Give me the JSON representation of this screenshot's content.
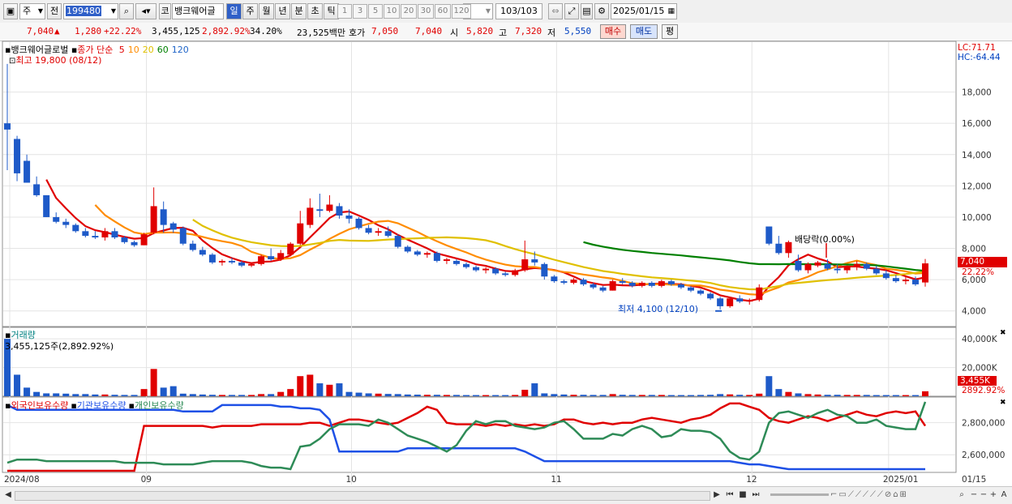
{
  "toolbar": {
    "market_type": "주",
    "prev_label": "전",
    "stock_code": "199480",
    "stock_name_tag": "코",
    "stock_name": "뱅크웨어글",
    "period_tabs": [
      "일",
      "주",
      "월",
      "년",
      "분",
      "초",
      "틱"
    ],
    "active_period": "일",
    "interval_buttons": [
      "1",
      "3",
      "5",
      "10",
      "20",
      "30",
      "60",
      "120"
    ],
    "page_counter": "103/103",
    "date": "2025/01/15"
  },
  "quote": {
    "price": "7,040",
    "change_arrow": "▲",
    "change": "1,280",
    "change_pct": "+22.22%",
    "volume": "3,455,125",
    "volume_pct": "2,892.92%",
    "turnover_pct": "34.20%",
    "amount": "23,525백만",
    "bid_label": "호가",
    "bid1": "7,050",
    "bid2": "7,040",
    "open_label": "시",
    "open": "5,820",
    "high_label": "고",
    "high": "7,320",
    "low_label": "저",
    "low": "5,550",
    "buy_label": "매수",
    "sell_label": "매도",
    "eval_label": "평"
  },
  "price_panel": {
    "stock_label": "뱅크웨어글로벌",
    "ma_prefix": "종가 단순",
    "ma_periods": [
      "5",
      "10",
      "20",
      "60",
      "120"
    ],
    "ma_colors": [
      "#e00000",
      "#ff8c00",
      "#e0c000",
      "#008000",
      "#1e64c8"
    ],
    "lc": "LC:71.71",
    "hc": "HC:-64.44",
    "highest_annotation": "최고 19,800 (08/12)",
    "lowest_annotation": "최저 4,100 (12/10)",
    "dividend_annotation": "배당락(0.00%)",
    "y_ticks": [
      "18,000",
      "16,000",
      "14,000",
      "12,000",
      "10,000",
      "8,000",
      "6,000",
      "4,000"
    ],
    "last_price_tag": "7,040",
    "last_pct_tag": "22.22%"
  },
  "volume_panel": {
    "label": "거래량",
    "value_text": "3,455,125주(2,892.92%)",
    "y_ticks": [
      "40,000K",
      "20,000K"
    ],
    "last_tag": "3,455K",
    "last_pct_tag": "2892.92%"
  },
  "holdings_panel": {
    "labels": [
      "외국인보유수량",
      "기관보유수량",
      "개인보유수량"
    ],
    "colors": [
      "#e00000",
      "#1e50e6",
      "#2e8b57"
    ],
    "y_ticks": [
      "2,800,000",
      "2,600,000"
    ]
  },
  "x_axis": {
    "labels": [
      "2024/08",
      "09",
      "10",
      "11",
      "12",
      "2025/01"
    ],
    "right_label": "01/15"
  },
  "chart_data": {
    "type": "candlestick",
    "ohlc": [
      [
        16000,
        19800,
        13000,
        15600
      ],
      [
        15000,
        15200,
        12300,
        12800
      ],
      [
        13600,
        14000,
        12200,
        12200
      ],
      [
        12100,
        12600,
        11300,
        11400
      ],
      [
        11400,
        11400,
        10000,
        10000
      ],
      [
        10000,
        10300,
        9600,
        9700
      ],
      [
        9700,
        9900,
        9300,
        9500
      ],
      [
        9500,
        9600,
        9000,
        9100
      ],
      [
        9100,
        9300,
        8700,
        8800
      ],
      [
        8800,
        9100,
        8600,
        8700
      ],
      [
        8700,
        9300,
        8500,
        9100
      ],
      [
        9100,
        9300,
        8600,
        8700
      ],
      [
        8700,
        8800,
        8300,
        8400
      ],
      [
        8400,
        8500,
        8100,
        8200
      ],
      [
        8200,
        9000,
        8200,
        8900
      ],
      [
        9000,
        11900,
        8900,
        10700
      ],
      [
        10500,
        11000,
        9000,
        9500
      ],
      [
        9600,
        9700,
        9000,
        9200
      ],
      [
        9300,
        9400,
        8200,
        8300
      ],
      [
        8300,
        8500,
        7800,
        7900
      ],
      [
        7900,
        8100,
        7500,
        7600
      ],
      [
        7600,
        7700,
        7000,
        7100
      ],
      [
        7100,
        7300,
        6900,
        7200
      ],
      [
        7200,
        7400,
        7000,
        7100
      ],
      [
        7100,
        7200,
        6800,
        6900
      ],
      [
        6900,
        7100,
        6800,
        7000
      ],
      [
        7000,
        7600,
        6900,
        7500
      ],
      [
        7500,
        8000,
        7200,
        7300
      ],
      [
        7300,
        7900,
        7200,
        7700
      ],
      [
        7600,
        8400,
        7500,
        8300
      ],
      [
        8300,
        10400,
        8200,
        9600
      ],
      [
        9500,
        11200,
        9300,
        10600
      ],
      [
        10500,
        11500,
        10000,
        10400
      ],
      [
        10400,
        11400,
        10300,
        10800
      ],
      [
        10700,
        10900,
        9900,
        10100
      ],
      [
        10100,
        10500,
        9600,
        9900
      ],
      [
        9900,
        10000,
        9200,
        9300
      ],
      [
        9300,
        9500,
        8900,
        9000
      ],
      [
        9000,
        9300,
        8800,
        9100
      ],
      [
        9100,
        9400,
        8700,
        8800
      ],
      [
        8800,
        8900,
        8000,
        8100
      ],
      [
        8100,
        8200,
        7700,
        7800
      ],
      [
        7800,
        7900,
        7500,
        7600
      ],
      [
        7600,
        7800,
        7400,
        7700
      ],
      [
        7700,
        7800,
        7100,
        7200
      ],
      [
        7200,
        7400,
        7000,
        7300
      ],
      [
        7200,
        7300,
        6900,
        7000
      ],
      [
        7000,
        7100,
        6700,
        6800
      ],
      [
        6800,
        6900,
        6500,
        6600
      ],
      [
        6600,
        6800,
        6400,
        6700
      ],
      [
        6700,
        6800,
        6300,
        6400
      ],
      [
        6400,
        6500,
        6200,
        6300
      ],
      [
        6300,
        6700,
        6200,
        6600
      ],
      [
        6600,
        8500,
        6500,
        7300
      ],
      [
        7300,
        7800,
        6900,
        7100
      ],
      [
        7000,
        7100,
        6000,
        6200
      ],
      [
        6200,
        6300,
        5800,
        5900
      ],
      [
        5900,
        6000,
        5700,
        5800
      ],
      [
        5800,
        6100,
        5700,
        6000
      ],
      [
        6000,
        6100,
        5600,
        5700
      ],
      [
        5700,
        5800,
        5400,
        5500
      ],
      [
        5500,
        5600,
        5200,
        5300
      ],
      [
        5300,
        6000,
        5300,
        5900
      ],
      [
        5900,
        6100,
        5700,
        5800
      ],
      [
        5800,
        5900,
        5500,
        5600
      ],
      [
        5600,
        5900,
        5500,
        5800
      ],
      [
        5800,
        5900,
        5500,
        5600
      ],
      [
        5600,
        6000,
        5500,
        5900
      ],
      [
        5900,
        6000,
        5600,
        5700
      ],
      [
        5700,
        5800,
        5400,
        5500
      ],
      [
        5500,
        5600,
        5200,
        5300
      ],
      [
        5300,
        5400,
        5000,
        5100
      ],
      [
        5100,
        5200,
        4700,
        4800
      ],
      [
        4800,
        4900,
        4100,
        4300
      ],
      [
        4300,
        4900,
        4200,
        4800
      ],
      [
        4800,
        5000,
        4500,
        4600
      ],
      [
        4600,
        4800,
        4400,
        4700
      ],
      [
        4700,
        5700,
        4600,
        5500
      ],
      [
        9400,
        9400,
        8200,
        8300
      ],
      [
        8300,
        8800,
        7600,
        7700
      ],
      [
        7700,
        8500,
        7400,
        8400
      ],
      [
        7200,
        7600,
        6500,
        6600
      ],
      [
        6600,
        7100,
        6400,
        7000
      ],
      [
        6900,
        7200,
        6800,
        7100
      ],
      [
        7000,
        7300,
        6600,
        6700
      ],
      [
        6700,
        7000,
        6400,
        6600
      ],
      [
        6600,
        6900,
        6400,
        6800
      ],
      [
        6800,
        7200,
        6600,
        7000
      ],
      [
        7000,
        7100,
        6600,
        6700
      ],
      [
        6700,
        6900,
        6300,
        6400
      ],
      [
        6400,
        6600,
        6000,
        6100
      ],
      [
        6100,
        6300,
        5800,
        5900
      ],
      [
        5900,
        6200,
        5700,
        6000
      ],
      [
        6000,
        6200,
        5600,
        5700
      ],
      [
        5820,
        7320,
        5550,
        7040
      ]
    ],
    "volume_k": [
      40000,
      15000,
      6000,
      3000,
      2000,
      2000,
      1800,
      1500,
      1500,
      1200,
      1200,
      1000,
      900,
      900,
      5000,
      19000,
      6000,
      7000,
      1800,
      1500,
      1200,
      1000,
      900,
      900,
      900,
      900,
      1500,
      1500,
      3000,
      5000,
      14000,
      15000,
      9000,
      8000,
      9000,
      3000,
      2500,
      2000,
      1800,
      1600,
      1500,
      1200,
      1100,
      1000,
      1000,
      900,
      900,
      800,
      800,
      800,
      800,
      800,
      900,
      4500,
      9000,
      2000,
      1500,
      1200,
      1000,
      1000,
      900,
      900,
      1500,
      1000,
      900,
      900,
      900,
      900,
      800,
      800,
      800,
      900,
      1000,
      1500,
      1300,
      1000,
      900,
      1800,
      14000,
      5000,
      3000,
      2000,
      1500,
      1200,
      1000,
      1000,
      900,
      900,
      900,
      800,
      800,
      800,
      800,
      800,
      3455
    ],
    "holdings_foreign": [
      2500000,
      2500000,
      2500000,
      2500000,
      2500000,
      2500000,
      2500000,
      2500000,
      2500000,
      2500000,
      2500000,
      2500000,
      2500000,
      2500000,
      2780000,
      2780000,
      2780000,
      2780000,
      2780000,
      2780000,
      2780000,
      2770000,
      2780000,
      2780000,
      2780000,
      2780000,
      2790000,
      2790000,
      2790000,
      2790000,
      2790000,
      2800000,
      2800000,
      2780000,
      2800000,
      2820000,
      2820000,
      2810000,
      2800000,
      2790000,
      2800000,
      2830000,
      2860000,
      2900000,
      2880000,
      2800000,
      2790000,
      2790000,
      2790000,
      2780000,
      2790000,
      2780000,
      2790000,
      2780000,
      2790000,
      2780000,
      2790000,
      2820000,
      2820000,
      2800000,
      2790000,
      2800000,
      2790000,
      2800000,
      2800000,
      2820000,
      2830000,
      2820000,
      2810000,
      2800000,
      2820000,
      2830000,
      2850000,
      2890000,
      2920000,
      2920000,
      2900000,
      2880000,
      2830000,
      2810000,
      2800000,
      2820000,
      2840000,
      2830000,
      2810000,
      2830000,
      2850000,
      2870000,
      2850000,
      2840000,
      2860000,
      2870000,
      2860000,
      2870000,
      2780000
    ],
    "holdings_institution": [
      2910000,
      2880000,
      2880000,
      2880000,
      2880000,
      2880000,
      2880000,
      2880000,
      2880000,
      2880000,
      2880000,
      2880000,
      2880000,
      2880000,
      2880000,
      2880000,
      2880000,
      2880000,
      2870000,
      2870000,
      2870000,
      2870000,
      2910000,
      2910000,
      2910000,
      2910000,
      2910000,
      2910000,
      2900000,
      2900000,
      2890000,
      2890000,
      2880000,
      2820000,
      2620000,
      2620000,
      2620000,
      2620000,
      2620000,
      2620000,
      2620000,
      2640000,
      2640000,
      2640000,
      2640000,
      2640000,
      2640000,
      2640000,
      2640000,
      2640000,
      2640000,
      2640000,
      2640000,
      2620000,
      2590000,
      2560000,
      2560000,
      2560000,
      2560000,
      2560000,
      2560000,
      2560000,
      2560000,
      2560000,
      2560000,
      2560000,
      2560000,
      2560000,
      2560000,
      2560000,
      2560000,
      2560000,
      2560000,
      2560000,
      2560000,
      2550000,
      2540000,
      2540000,
      2530000,
      2520000,
      2510000,
      2510000,
      2510000,
      2510000,
      2510000,
      2510000,
      2510000,
      2510000,
      2510000,
      2510000,
      2510000,
      2510000,
      2510000,
      2510000,
      2510000
    ],
    "holdings_individual": [
      2550000,
      2570000,
      2570000,
      2570000,
      2560000,
      2560000,
      2560000,
      2560000,
      2560000,
      2560000,
      2560000,
      2560000,
      2550000,
      2550000,
      2550000,
      2550000,
      2540000,
      2540000,
      2540000,
      2540000,
      2550000,
      2560000,
      2560000,
      2560000,
      2560000,
      2550000,
      2530000,
      2520000,
      2520000,
      2510000,
      2650000,
      2660000,
      2700000,
      2760000,
      2790000,
      2790000,
      2790000,
      2780000,
      2820000,
      2800000,
      2760000,
      2720000,
      2700000,
      2680000,
      2650000,
      2620000,
      2660000,
      2750000,
      2810000,
      2790000,
      2810000,
      2810000,
      2780000,
      2770000,
      2760000,
      2770000,
      2800000,
      2810000,
      2760000,
      2700000,
      2700000,
      2700000,
      2730000,
      2720000,
      2760000,
      2780000,
      2760000,
      2710000,
      2720000,
      2760000,
      2750000,
      2750000,
      2740000,
      2700000,
      2620000,
      2580000,
      2570000,
      2620000,
      2800000,
      2860000,
      2870000,
      2850000,
      2830000,
      2860000,
      2880000,
      2850000,
      2840000,
      2800000,
      2800000,
      2820000,
      2780000,
      2770000,
      2760000,
      2760000,
      2930000
    ],
    "price_ylim": [
      3000,
      20000
    ],
    "volume_ylim": [
      0,
      48000
    ],
    "holdings_ylim": [
      2490000,
      2960000
    ]
  }
}
